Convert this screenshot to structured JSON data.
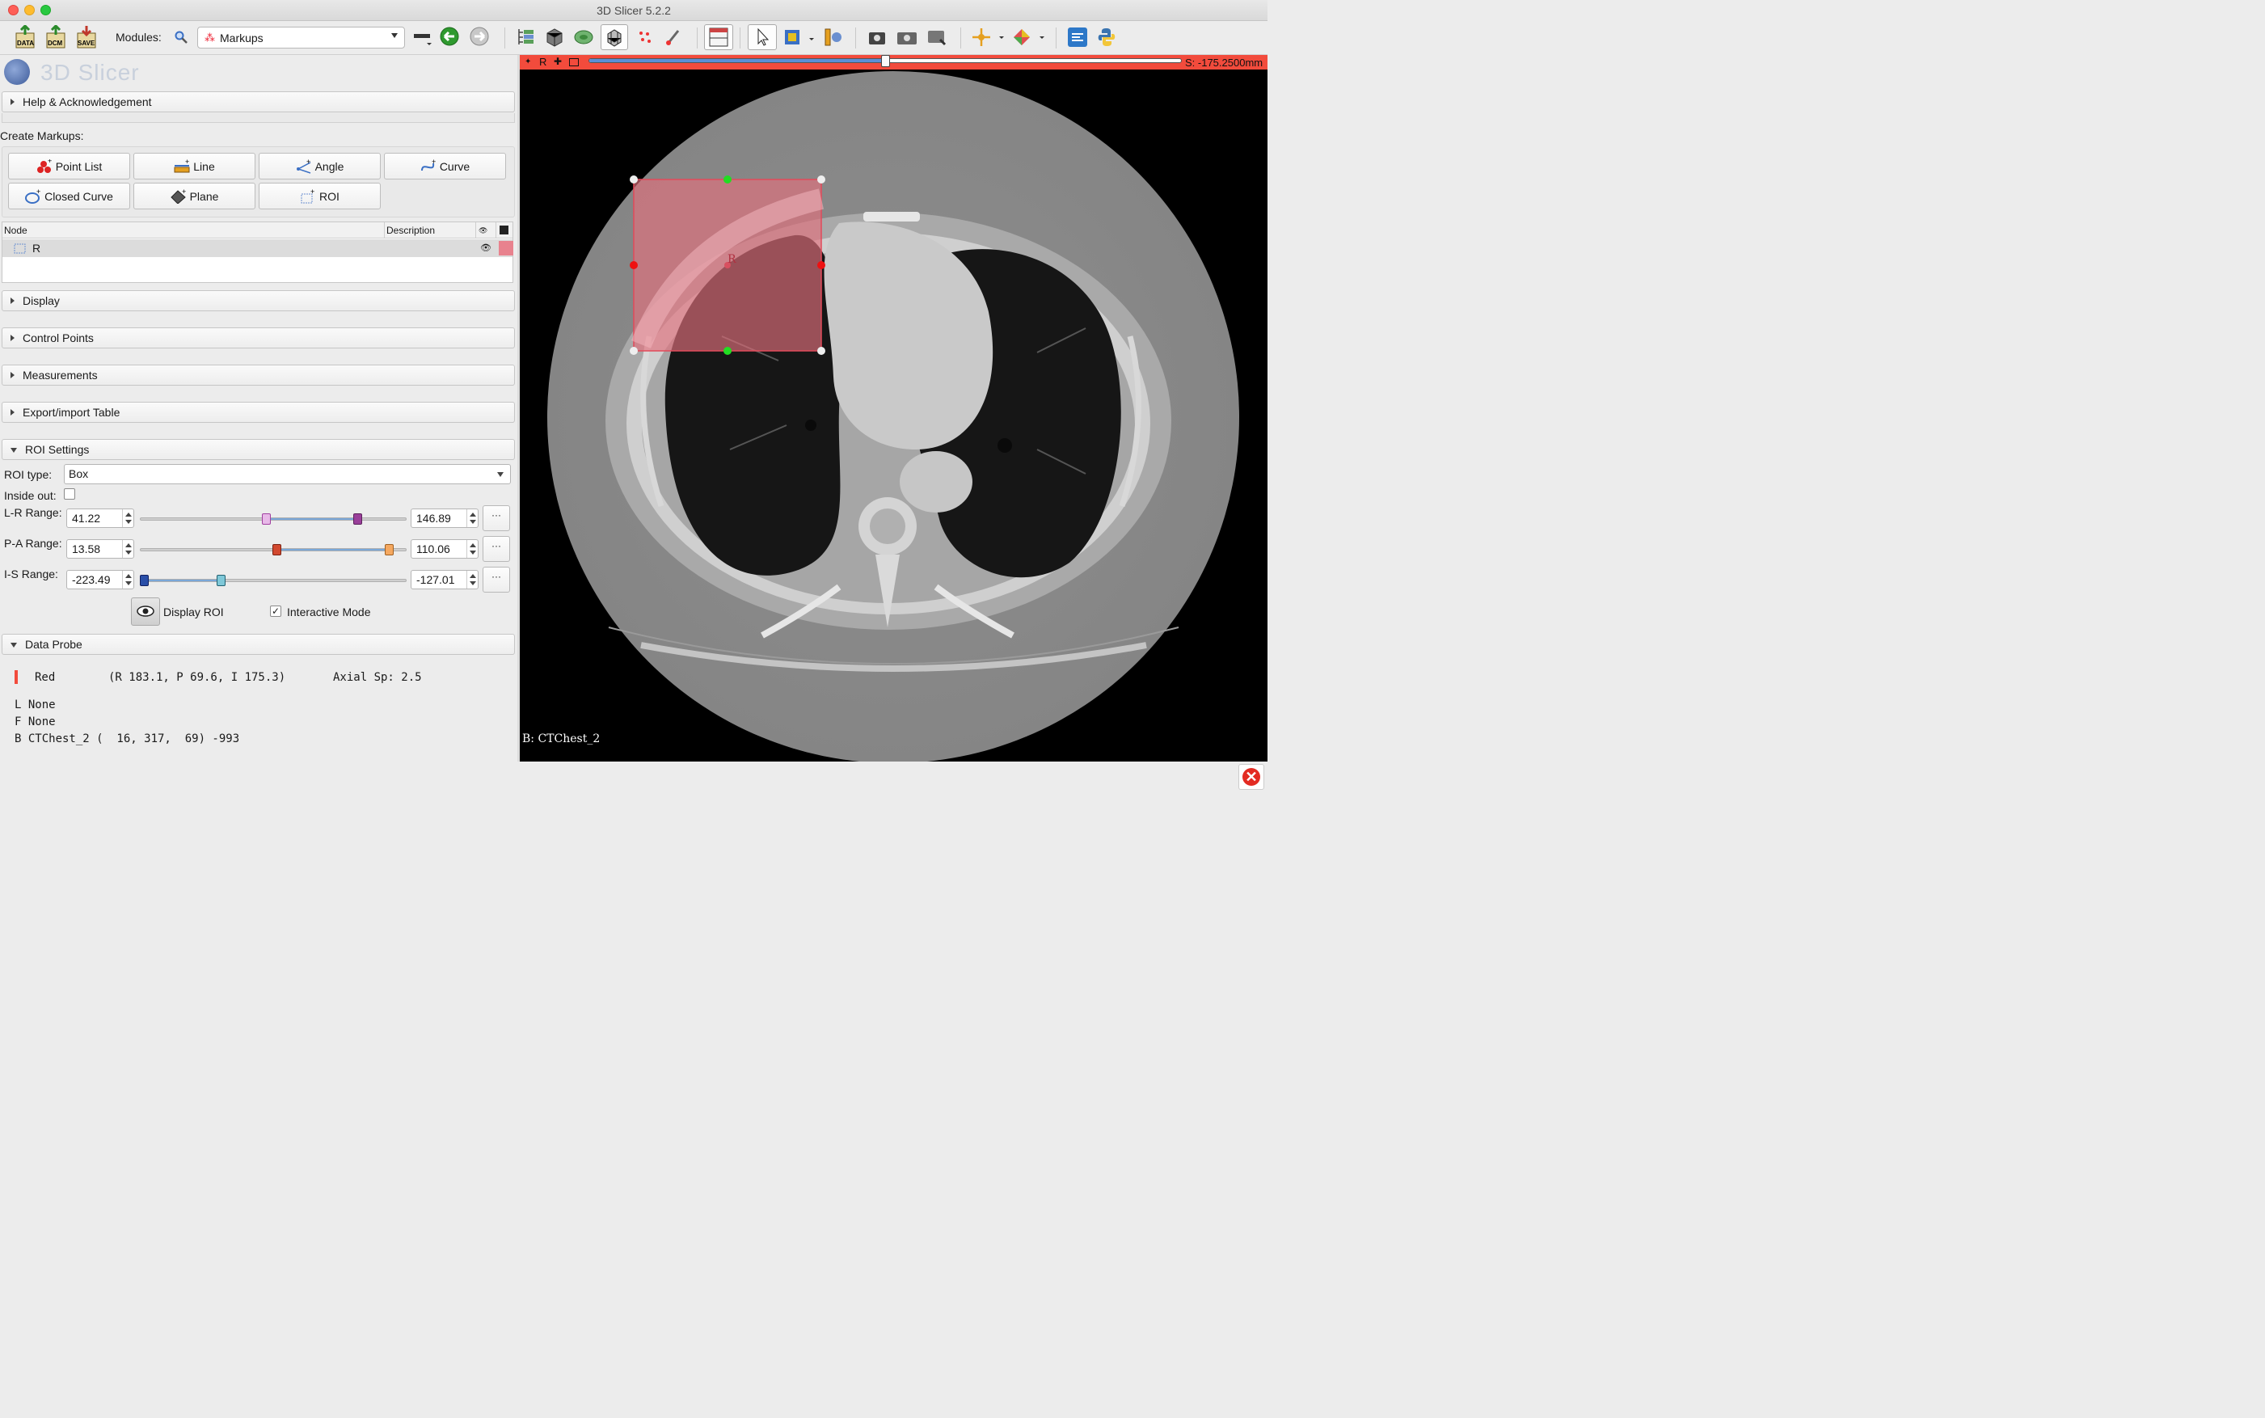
{
  "window": {
    "title": "3D Slicer 5.2.2"
  },
  "toolbar": {
    "data_label": "DATA",
    "dcm_label": "DCM",
    "save_label": "SAVE",
    "modules_label": "Modules:",
    "module_selected": "Markups"
  },
  "panel": {
    "logo_text": "3D Slicer",
    "help_label": "Help & Acknowledgement",
    "create_markups_label": "Create Markups:",
    "buttons": {
      "point_list": "Point List",
      "line": "Line",
      "angle": "Angle",
      "curve": "Curve",
      "closed_curve": "Closed Curve",
      "plane": "Plane",
      "roi": "ROI"
    },
    "node_table": {
      "col_node": "Node",
      "col_description": "Description",
      "row_name": "R",
      "row_color": "#e8828e"
    },
    "sections": {
      "display": "Display",
      "control_points": "Control Points",
      "measurements": "Measurements",
      "export_import": "Export/import Table",
      "roi_settings": "ROI Settings",
      "data_probe": "Data Probe"
    },
    "roi": {
      "type_label": "ROI type:",
      "type_value": "Box",
      "inside_out_label": "Inside out:",
      "lr_label": "L-R Range:",
      "lr_min": "41.22",
      "lr_max": "146.89",
      "pa_label": "P-A Range:",
      "pa_min": "13.58",
      "pa_max": "110.06",
      "is_label": "I-S Range:",
      "is_min": "-223.49",
      "is_max": "-127.01",
      "more_label": "···",
      "display_roi_label": "Display ROI",
      "interactive_mode_label": "Interactive Mode",
      "interactive_mode_check": "✓"
    },
    "probe": {
      "view_name": "Red",
      "coords": "(R 183.1, P 69.6, I 175.3)",
      "orientation": "Axial Sp: 2.5",
      "l_line": "L None",
      "f_line": "F None",
      "b_line": "B CTChest_2 (  16, 317,  69) -993"
    }
  },
  "viewer": {
    "view_letter": "R",
    "slice_offset": "S: -175.2500mm",
    "slice_position": 0.5,
    "background_label": "B: CTChest_2",
    "roi_label": "R",
    "accent_color": "#f24b3c"
  }
}
